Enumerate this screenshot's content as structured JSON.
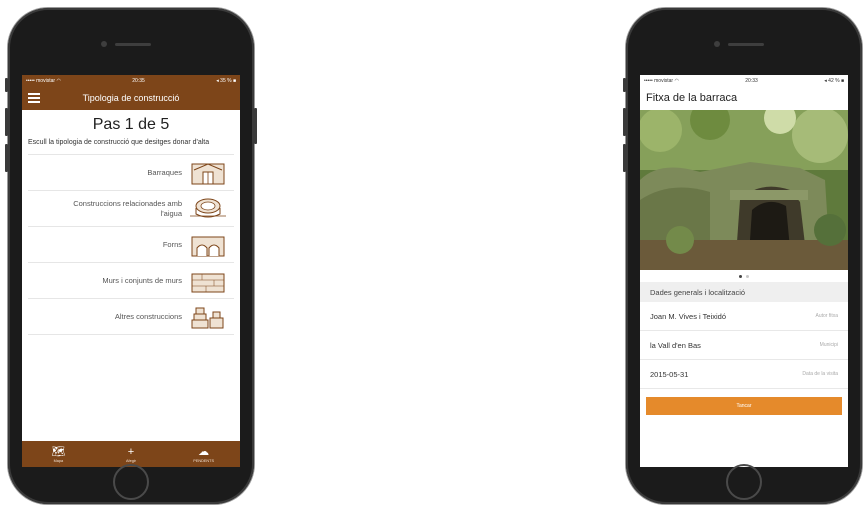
{
  "left_phone": {
    "status": {
      "carrier": "••••• movistar",
      "wifi_icon": "wifi-icon",
      "time": "20:35",
      "battery": "◂ 35 % ■"
    },
    "header": {
      "menu_icon": "hamburger-icon",
      "title": "Tipologia de construcció"
    },
    "step_title": "Pas 1 de 5",
    "instruction": "Escull la tipologia de construcció que desitges donar d'alta",
    "types": [
      {
        "label": "Barraques",
        "icon": "hut-icon"
      },
      {
        "label": "Construccions relacionades amb l'aigua",
        "icon": "well-icon"
      },
      {
        "label": "Forns",
        "icon": "kiln-icon"
      },
      {
        "label": "Murs i conjunts de murs",
        "icon": "wall-icon"
      },
      {
        "label": "Altres construccions",
        "icon": "stack-icon"
      }
    ],
    "tabbar": [
      {
        "label": "Mapa",
        "icon": "map-icon",
        "glyph": "🗺"
      },
      {
        "label": "Afegir",
        "icon": "plus-icon",
        "glyph": "+"
      },
      {
        "label": "PENDENTS",
        "icon": "cloud-upload-icon",
        "glyph": "☁"
      }
    ]
  },
  "right_phone": {
    "status": {
      "carrier": "••••• movistar",
      "wifi_icon": "wifi-icon",
      "time": "20:33",
      "battery": "◂ 42 % ■"
    },
    "title": "Fitxa de la barraca",
    "carousel": {
      "slides": 2,
      "active": 1
    },
    "section_title": "Dades generals i localització",
    "fields": [
      {
        "value": "Joan M. Vives i Teixidó",
        "label": "Autor fitxa"
      },
      {
        "value": "la Vall d'en Bas",
        "label": "Municipi"
      },
      {
        "value": "2015-05-31",
        "label": "Data de la visita"
      }
    ],
    "close_label": "Tancar",
    "colors": {
      "button": "#e58a2b"
    }
  },
  "colors": {
    "brand_brown": "#7d4519",
    "phone_body": "#1b1b1b"
  }
}
